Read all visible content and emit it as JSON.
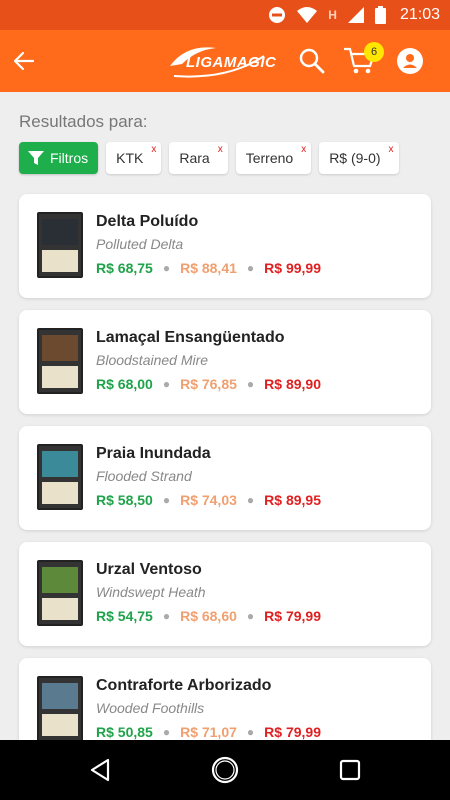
{
  "status_bar": {
    "time": "21:03",
    "icons": [
      "do-not-disturb-icon",
      "wifi-icon",
      "h-network-icon",
      "signal-icon",
      "battery-icon"
    ],
    "network_label": "H"
  },
  "app_bar": {
    "logo_text": "LIGAMAGIC",
    "cart_count": "6",
    "color": "#ff6b1a"
  },
  "results": {
    "label": "Resultados para:"
  },
  "filters": {
    "button_label": "Filtros",
    "chips": [
      {
        "label": "KTK",
        "remove": "x"
      },
      {
        "label": "Rara",
        "remove": "x"
      },
      {
        "label": "Terreno",
        "remove": "x"
      },
      {
        "label": "R$ (9-0)",
        "remove": "x"
      }
    ]
  },
  "cards": [
    {
      "name": "Delta Poluído",
      "english": "Polluted Delta",
      "price_low": "R$ 68,75",
      "price_mid": "R$ 88,41",
      "price_high": "R$ 99,99",
      "art_color": "#2a2f35"
    },
    {
      "name": "Lamaçal Ensangüentado",
      "english": "Bloodstained Mire",
      "price_low": "R$ 68,00",
      "price_mid": "R$ 76,85",
      "price_high": "R$ 89,90",
      "art_color": "#6b4a30"
    },
    {
      "name": "Praia Inundada",
      "english": "Flooded Strand",
      "price_low": "R$ 58,50",
      "price_mid": "R$ 74,03",
      "price_high": "R$ 89,95",
      "art_color": "#3a8a9a"
    },
    {
      "name": "Urzal Ventoso",
      "english": "Windswept Heath",
      "price_low": "R$ 54,75",
      "price_mid": "R$ 68,60",
      "price_high": "R$ 79,99",
      "art_color": "#5d8a3a"
    },
    {
      "name": "Contraforte Arborizado",
      "english": "Wooded Foothills",
      "price_low": "R$ 50,85",
      "price_mid": "R$ 71,07",
      "price_high": "R$ 79,99",
      "art_color": "#5a7a8f"
    }
  ],
  "colors": {
    "accent": "#ff6b1a",
    "status_bar": "#e8501a",
    "green": "#1fae4c",
    "price_low": "#1fa34a",
    "price_mid": "#f0a070",
    "price_high": "#e02020"
  }
}
